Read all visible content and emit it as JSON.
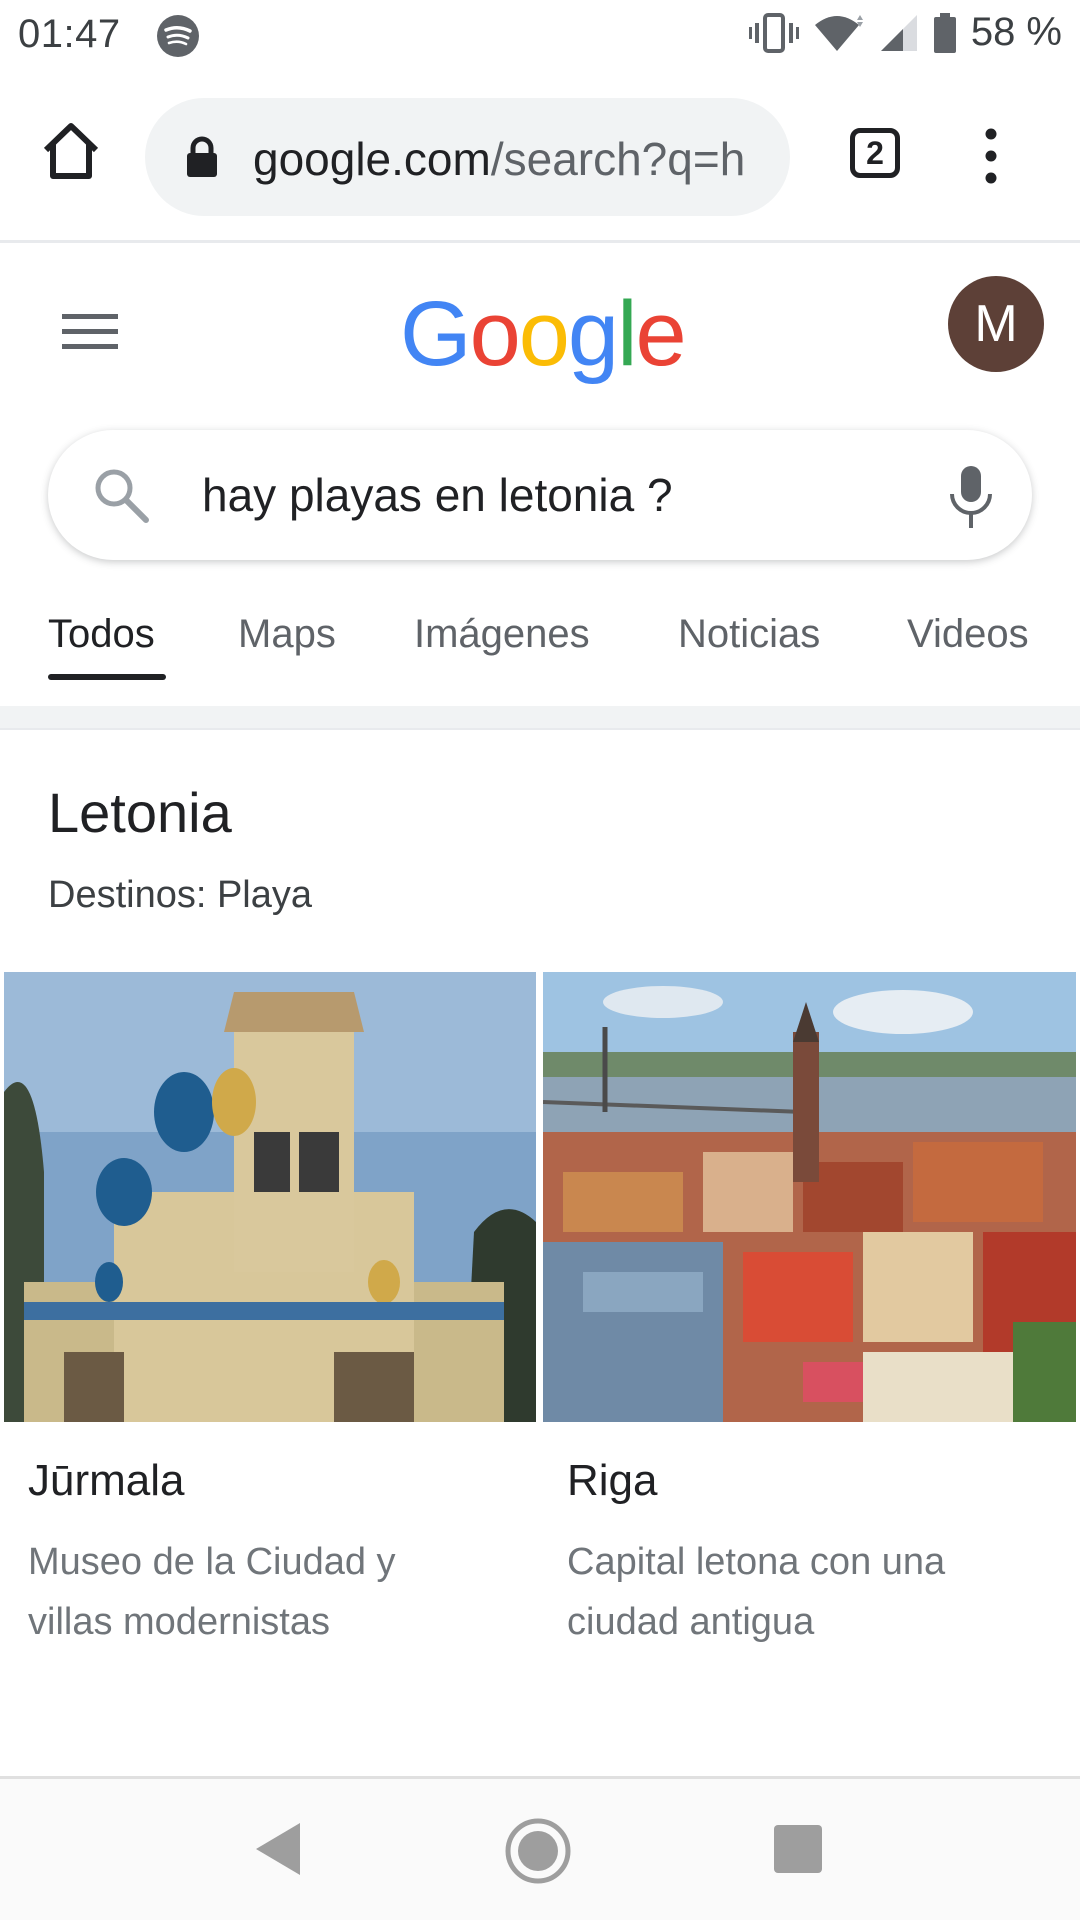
{
  "status_bar": {
    "time": "01:47",
    "battery_percent": "58 %",
    "icons": [
      "spotify-icon",
      "vibrate-icon",
      "wifi-icon",
      "signal-icon",
      "battery-icon"
    ]
  },
  "browser": {
    "url_domain": "google.com",
    "url_path": "/search?q=h",
    "tab_count": "2"
  },
  "google": {
    "logo_letters": [
      "G",
      "o",
      "o",
      "g",
      "l",
      "e"
    ],
    "logo_colors": [
      "#4285F4",
      "#EA4335",
      "#FBBC05",
      "#4285F4",
      "#34A853",
      "#EA4335"
    ],
    "avatar_letter": "M",
    "avatar_color": "#5d4037"
  },
  "search": {
    "query": "hay playas en letonia ?"
  },
  "tabs": [
    {
      "label": "Todos",
      "active": true
    },
    {
      "label": "Maps",
      "active": false
    },
    {
      "label": "Imágenes",
      "active": false
    },
    {
      "label": "Noticias",
      "active": false
    },
    {
      "label": "Videos",
      "active": false
    }
  ],
  "result": {
    "title": "Letonia",
    "subtitle": "Destinos: Playa",
    "cards": [
      {
        "name": "Jūrmala",
        "desc": "Museo de la Ciudad y villas modernistas"
      },
      {
        "name": "Riga",
        "desc": "Capital letona con una ciudad antigua"
      }
    ]
  }
}
